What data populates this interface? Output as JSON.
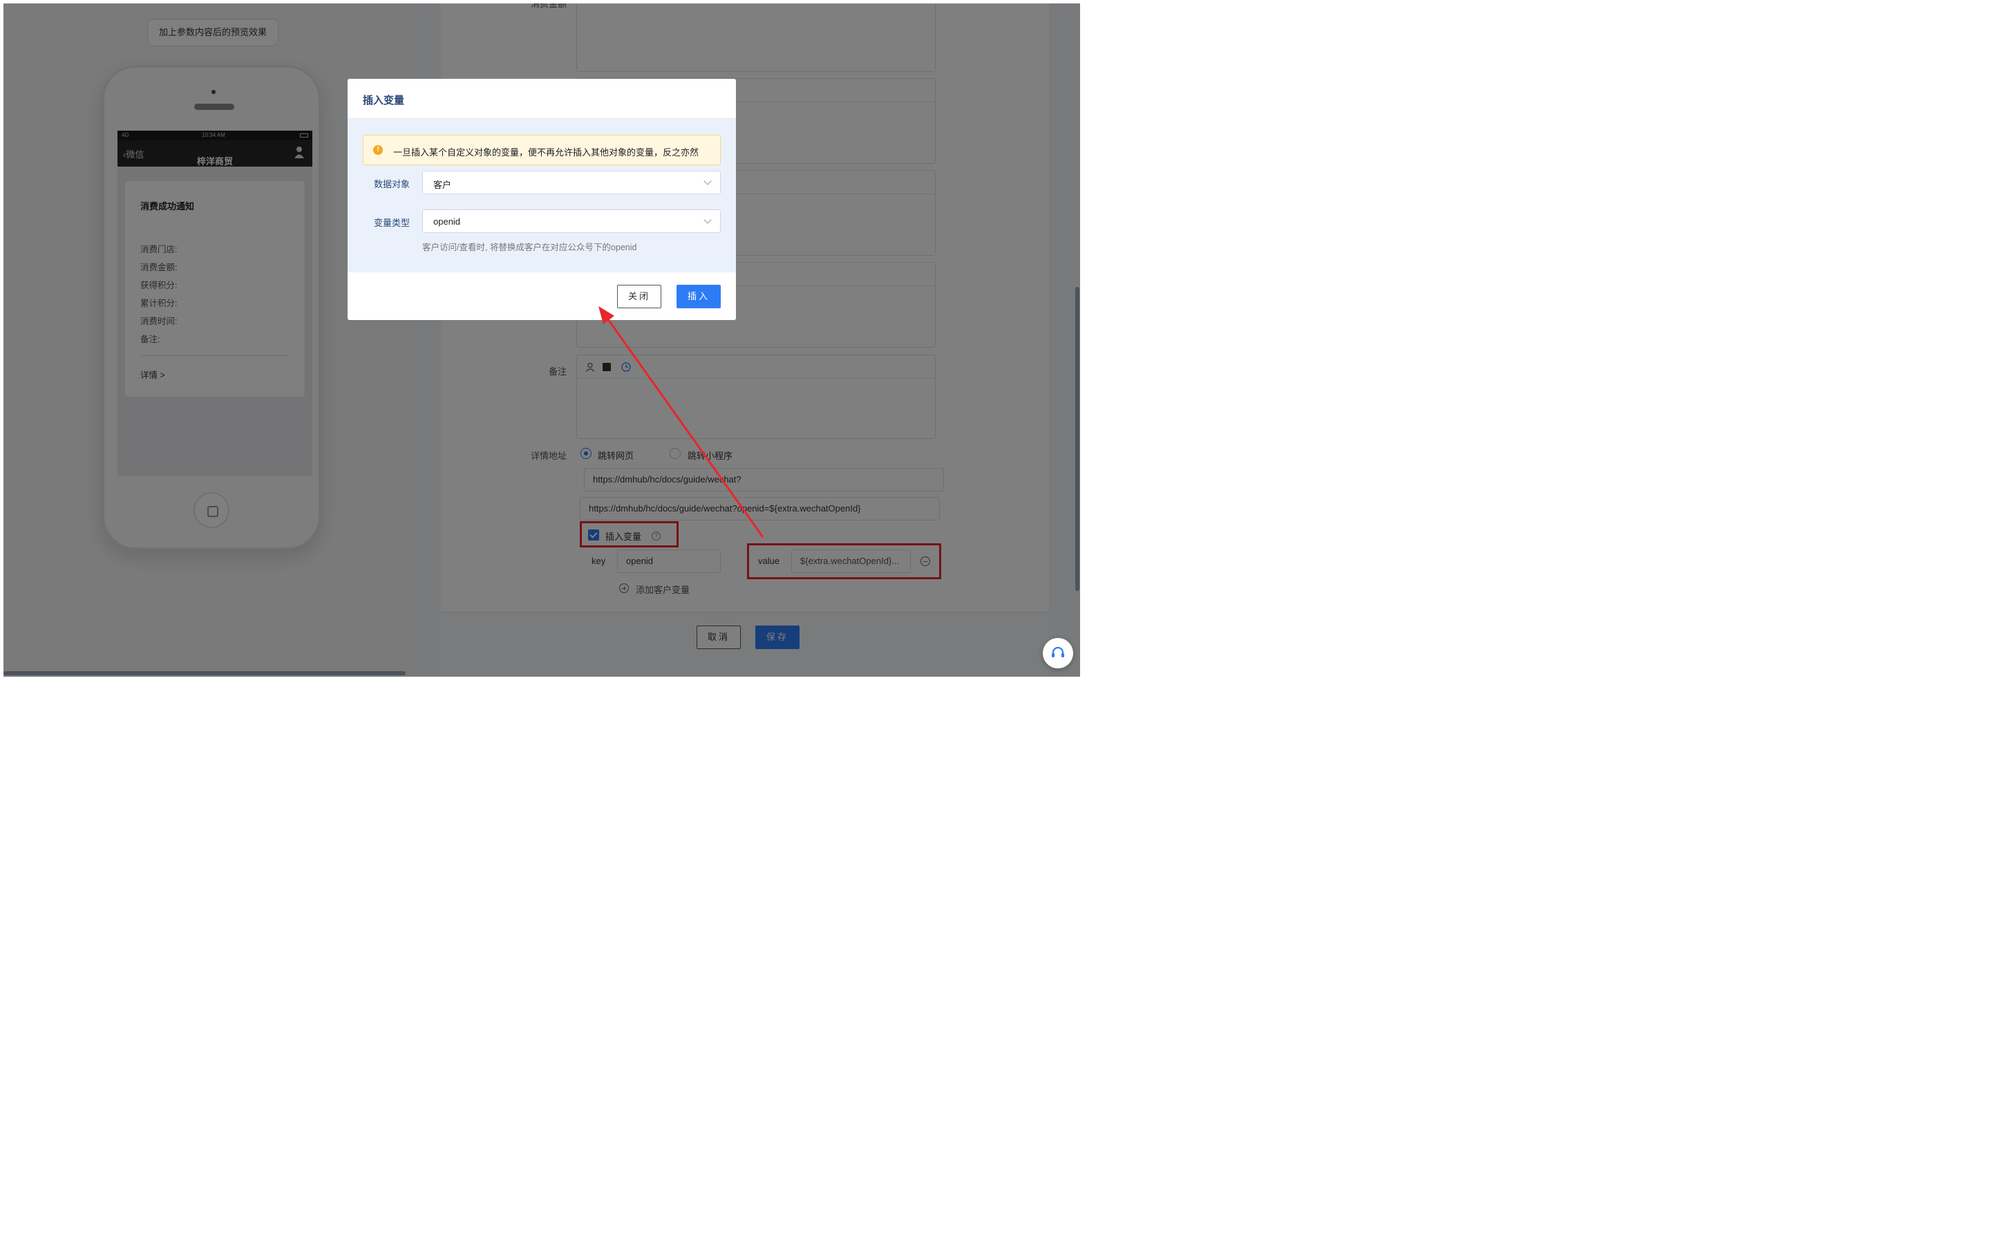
{
  "preview": {
    "badge": "加上参数内容后的预览效果",
    "phone_status_signal": "4G",
    "phone_status_time": "10:34 AM",
    "nav_back": "微信",
    "nav_title": "梓洋商贸",
    "card_title": "消费成功通知",
    "fields": [
      "消费门店:",
      "消费金额:",
      "获得积分:",
      "累计积分:",
      "消费时间:",
      "备注:"
    ],
    "detail_link": "详情 >"
  },
  "form": {
    "top_partial_label": "消费金额",
    "remark_label": "备注",
    "detail_url_label": "详情地址",
    "radio_webpage": "跳转网页",
    "radio_miniprogram": "跳转小程序",
    "url_input": "https://dmhub/hc/docs/guide/wechat?",
    "url_preview": "https://dmhub/hc/docs/guide/wechat?openid=${extra.wechatOpenId}",
    "insert_variable_label": "插入变量",
    "key_label": "key",
    "key_value": "openid",
    "value_label": "value",
    "value_value": "${extra.wechatOpenId}...",
    "add_customer_variable": "添加客户变量",
    "cancel_button": "取消",
    "save_button": "保存"
  },
  "modal": {
    "title": "插入变量",
    "alert": "一旦插入某个自定义对象的变量，便不再允许插入其他对象的变量，反之亦然",
    "data_object_label": "数据对象",
    "data_object_value": "客户",
    "var_type_label": "变量类型",
    "var_type_value": "openid",
    "hint": "客户访问/查看时, 将替换成客户在对应公众号下的openid",
    "close_button": "关闭",
    "insert_button": "插入"
  },
  "colors": {
    "primary": "#2d7cf6",
    "annotation_red": "#e8262d",
    "alert_bg": "#fff7e0",
    "alert_icon": "#f5a623"
  }
}
